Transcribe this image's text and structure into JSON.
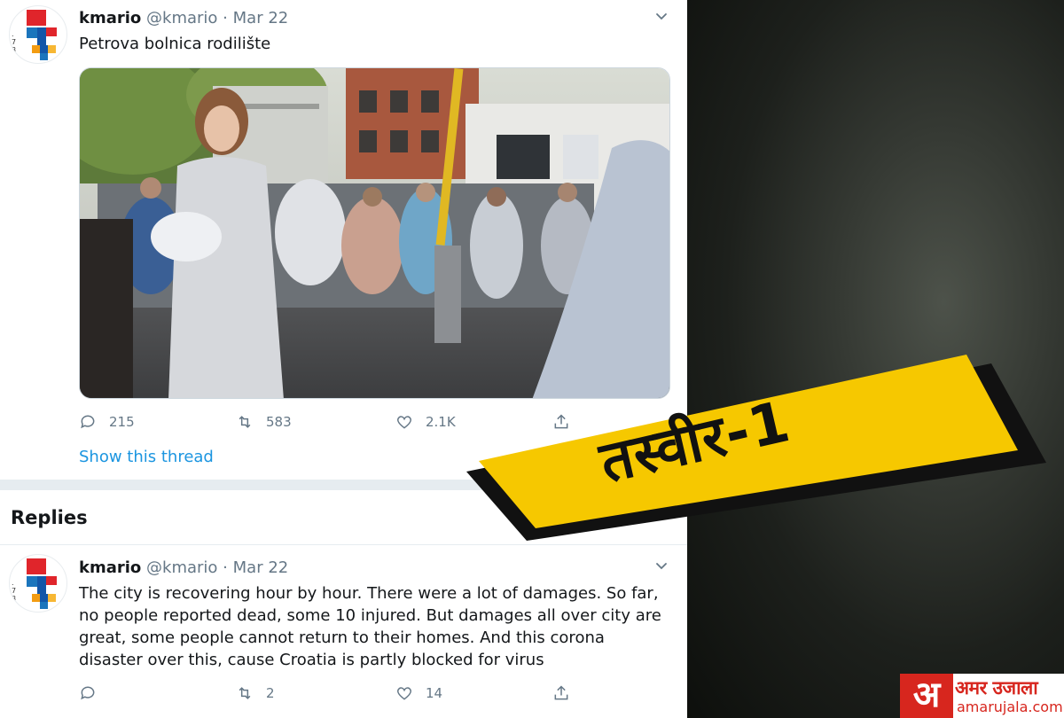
{
  "tweet": {
    "name": "kmario",
    "handle": "@kmario",
    "separator": "·",
    "date": "Mar 22",
    "text": "Petrova bolnica rodilište",
    "reply_count": "215",
    "retweet_count": "583",
    "like_count": "2.1K",
    "show_thread": "Show this thread"
  },
  "replies_heading": "Replies",
  "reply": {
    "name": "kmario",
    "handle": "@kmario",
    "separator": "·",
    "date": "Mar 22",
    "text": "The city is recovering hour by hour. There were a lot of damages. So far, no people reported dead, some 10 injured. But damages all over city are great, some people cannot return to their homes. And this corona disaster over this, cause Croatia is partly blocked for virus",
    "reply_count": "",
    "retweet_count": "2",
    "like_count": "14"
  },
  "banner": {
    "text": "तस्वीर-1",
    "color": "#f6c800"
  },
  "logo": {
    "mark": "अ",
    "title": "अमर उजाला",
    "url": "amarujala.com",
    "color": "#d7261e"
  },
  "colors": {
    "link": "#1b95e0",
    "muted": "#657786",
    "text": "#14171a",
    "separator": "#e6ecf0"
  },
  "icons": {
    "reply": "reply-icon",
    "retweet": "retweet-icon",
    "like": "heart-icon",
    "share": "share-icon",
    "more": "chevron-down-icon"
  }
}
